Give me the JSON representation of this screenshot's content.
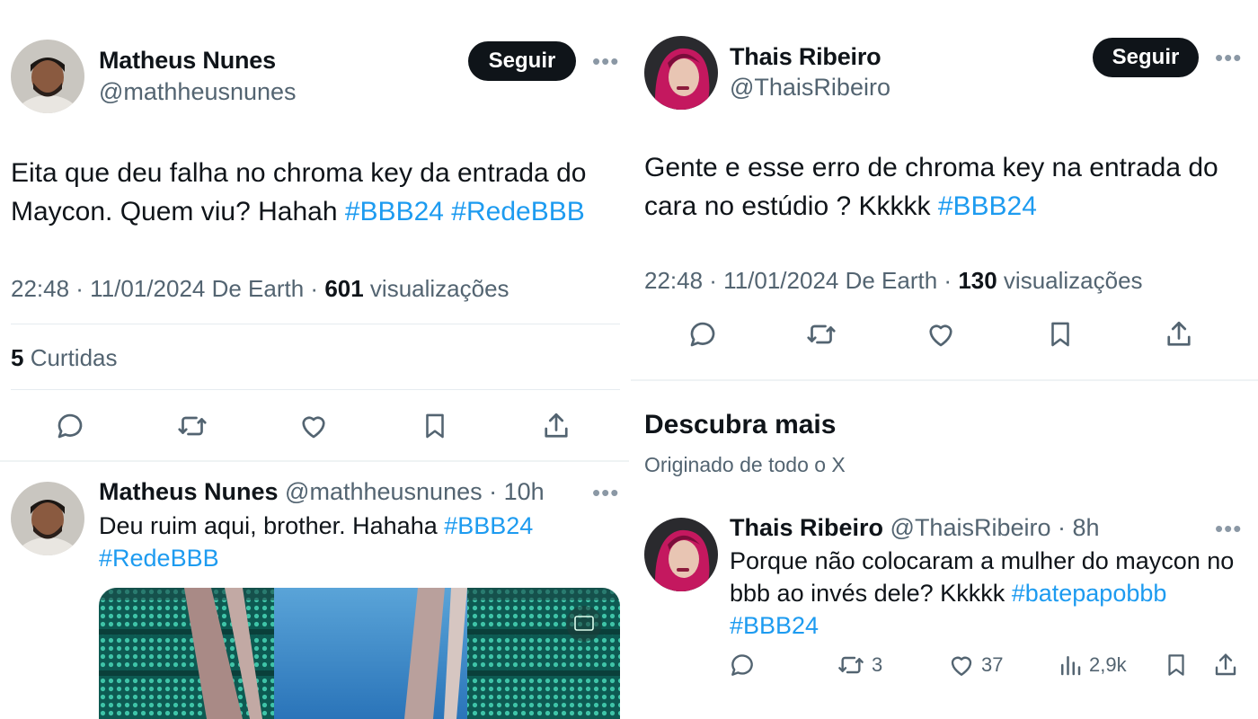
{
  "left": {
    "post": {
      "author_name": "Matheus Nunes",
      "author_handle": "@mathheusnunes",
      "follow_label": "Seguir",
      "more_label": "•••",
      "text_plain": "Eita que deu falha no chroma key da entrada do Maycon. Quem viu? Hahah ",
      "tag1": "#BBB24",
      "tag2": "#RedeBBB",
      "meta_prefix": "22:48 · 11/01/2024 De Earth · ",
      "views_count": "601",
      "views_label": " visualizações",
      "likes_count": "5",
      "likes_label": " Curtidas"
    },
    "reply": {
      "author_name": "Matheus Nunes",
      "author_handle": " @mathheusnunes",
      "time": " · 10h",
      "more_label": "•••",
      "text_plain": "Deu ruim aqui, brother. Hahaha ",
      "tag1": "#BBB24",
      "tag2": "#RedeBBB"
    }
  },
  "right": {
    "post": {
      "author_name": "Thais Ribeiro",
      "author_handle": "@ThaisRibeiro",
      "follow_label": "Seguir",
      "more_label": "•••",
      "text_plain": "Gente e esse erro de chroma key na entrada do cara no estúdio ? Kkkkk ",
      "tag1": "#BBB24",
      "meta_prefix": "22:48 · 11/01/2024 De Earth · ",
      "views_count": "130",
      "views_label": " visualizações"
    },
    "discover": {
      "title": "Descubra mais",
      "subtitle": "Originado de todo o X"
    },
    "reply": {
      "author_name": "Thais Ribeiro",
      "author_handle": " @ThaisRibeiro",
      "time": " · 8h",
      "more_label": "•••",
      "text_plain": "Porque não colocaram a mulher do maycon no bbb ao invés dele? Kkkkk ",
      "tag1": "#batepapobbb",
      "tag2": "#BBB24",
      "retweets": "3",
      "likes": "37",
      "views": "2,9k"
    }
  },
  "icons": [
    "reply-icon",
    "retweet-icon",
    "like-icon",
    "bookmark-icon",
    "share-icon",
    "views-icon"
  ],
  "colors": {
    "link": "#1d9bf0",
    "text": "#0f1419",
    "secondary": "#536471",
    "button": "#0f1419"
  }
}
